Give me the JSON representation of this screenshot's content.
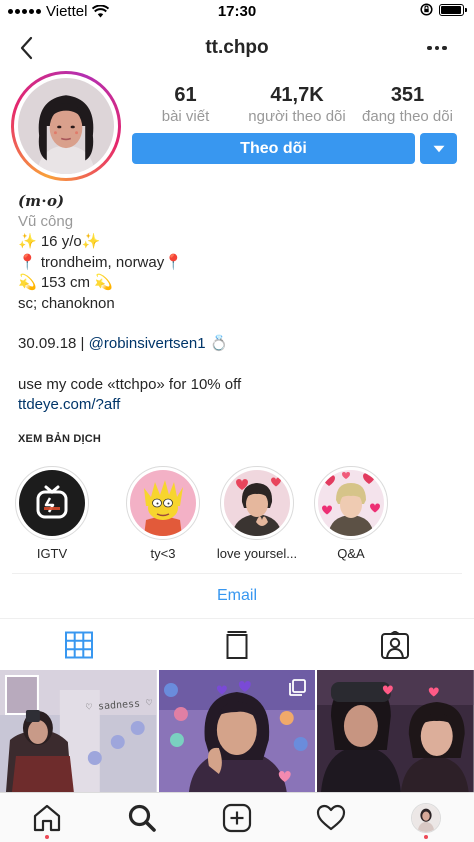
{
  "status_bar": {
    "carrier": "Viettel",
    "time": "17:30",
    "battery_level": 0.95
  },
  "nav": {
    "title": "tt.chpo"
  },
  "stats": [
    {
      "value": "61",
      "label": "bài viết"
    },
    {
      "value": "41,7K",
      "label": "người theo dõi"
    },
    {
      "value": "351",
      "label": "đang theo dõi"
    }
  ],
  "follow_button": {
    "label": "Theo dõi"
  },
  "bio": {
    "name": "(𝒎⋅𝒐)",
    "category": "Vũ công",
    "lines": [
      "✨ 16 y/o✨",
      "📍 trondheim, norway📍",
      "💫 153 cm 💫",
      "sc; chanoknon"
    ],
    "date_prefix": "30.09.18 | ",
    "mention": "@robinsivertsen1",
    "date_suffix": " 💍",
    "promo": "use my code «ttchpo» for 10% off",
    "link": "ttdeye.com/?aff"
  },
  "translate_label": "XEM BẢN DỊCH",
  "highlights": [
    {
      "label": "IGTV"
    },
    {
      "label": "ty<3"
    },
    {
      "label": "love yoursel..."
    },
    {
      "label": "Q&A"
    }
  ],
  "email_label": "Email",
  "grid": [
    {
      "caption": "♡ sadness ♡"
    },
    {
      "caption": ""
    },
    {
      "caption": ""
    }
  ],
  "colors": {
    "accent": "#3897f0",
    "text": "#262626",
    "secondary": "#999999",
    "link": "#003569",
    "notification": "#ed4956"
  },
  "icons": {
    "back": "chevron-left-icon",
    "more": "ellipsis-icon",
    "grid_tab": "grid-icon",
    "igtv_tab": "igtv-icon",
    "tagged_tab": "tagged-icon",
    "home": "home-icon",
    "search": "search-icon",
    "add": "add-post-icon",
    "activity": "heart-icon",
    "profile": "profile-avatar"
  }
}
